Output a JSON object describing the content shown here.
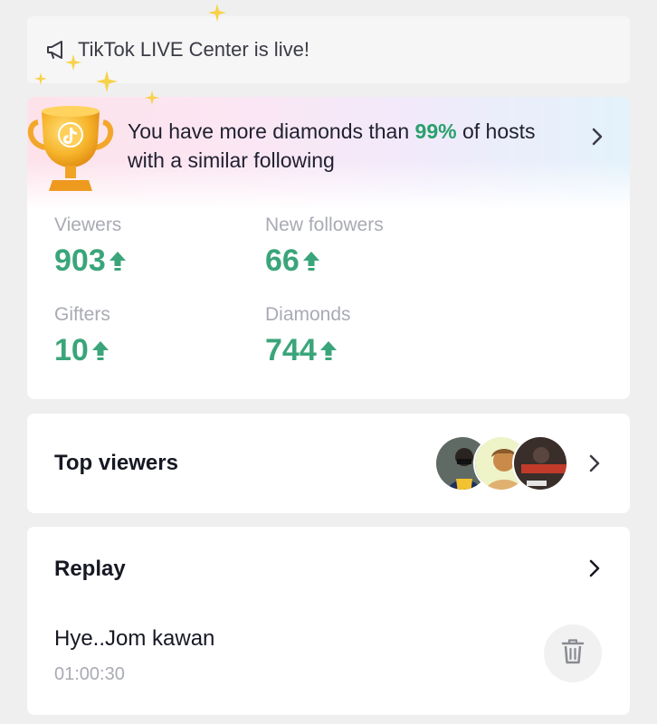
{
  "announcement": {
    "icon": "megaphone-icon",
    "text": "TikTok LIVE Center is live!"
  },
  "stats": {
    "banner": {
      "text_before": "You have more diamonds than ",
      "highlight": "99%",
      "text_after": " of hosts with a similar following"
    },
    "metrics": [
      {
        "label": "Viewers",
        "value": "903",
        "trend": "up"
      },
      {
        "label": "New followers",
        "value": "66",
        "trend": "up"
      },
      {
        "label": "Gifters",
        "value": "10",
        "trend": "up"
      },
      {
        "label": "Diamonds",
        "value": "744",
        "trend": "up"
      }
    ]
  },
  "top_viewers": {
    "title": "Top viewers",
    "avatar_count": 3
  },
  "replay": {
    "title": "Replay",
    "item_name": "Hye..Jom kawan",
    "item_duration": "01:00:30"
  },
  "colors": {
    "accent_green": "#3aa57a",
    "highlight_green": "#2aa06c",
    "muted_text": "#a9abb3",
    "page_bg": "#efefef"
  }
}
